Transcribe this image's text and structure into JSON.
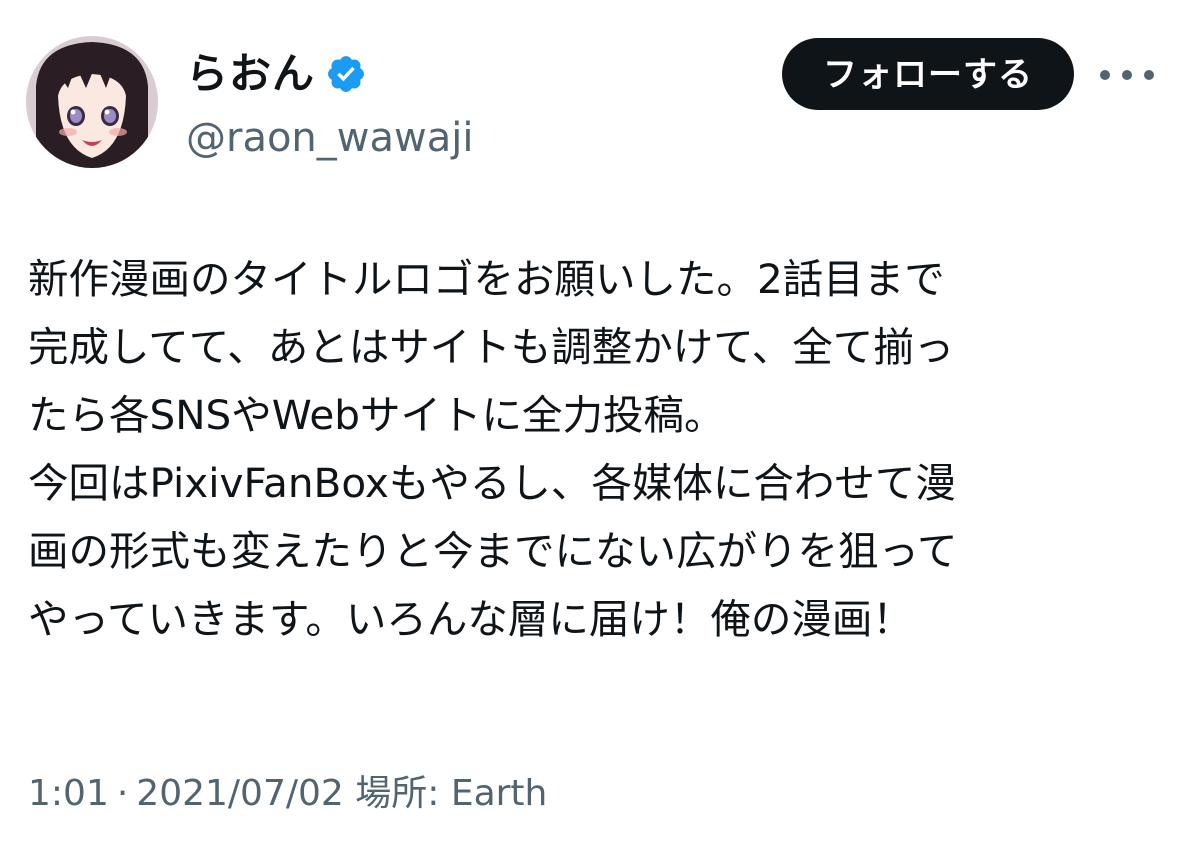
{
  "user": {
    "display_name": "らおん",
    "handle": "@raon_wawaji",
    "verified_icon": "verified-badge-icon"
  },
  "actions": {
    "follow_label": "フォローする",
    "more_icon": "more-horizontal-icon"
  },
  "tweet": {
    "lines": [
      "新作漫画のタイトルロゴをお願いした。2話目まで",
      "完成してて、あとはサイトも調整かけて、全て揃っ",
      "たら各SNSやWebサイトに全力投稿。",
      "今回はPixivFanBoxもやるし、各媒体に合わせて漫",
      "画の形式も変えたりと今までにない広がりを狙って",
      "やっていきます。いろんな層に届け！俺の漫画！"
    ]
  },
  "meta": {
    "time": "1:01",
    "separator": "·",
    "date": "2021/07/02",
    "location": "場所: Earth"
  },
  "colors": {
    "text": "#0f1419",
    "secondary": "#536471",
    "verified_blue": "#1d9bf0",
    "follow_bg": "#0f1419"
  }
}
